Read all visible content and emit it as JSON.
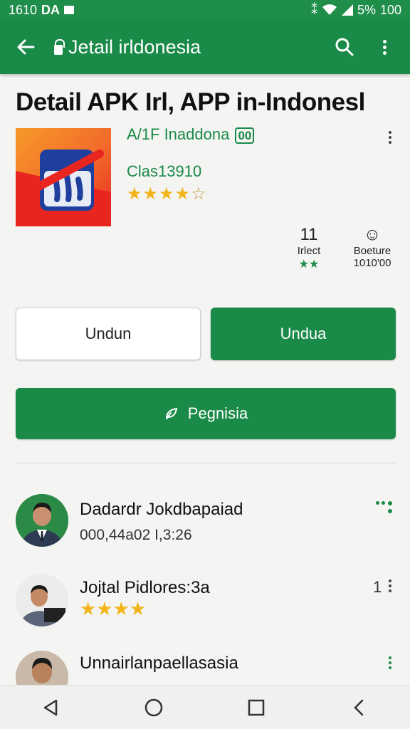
{
  "status_bar": {
    "time": "1610",
    "carrier": "DA",
    "battery": "5%",
    "signal_text": "100"
  },
  "app_bar": {
    "title": "Jetail irldonesia"
  },
  "page": {
    "title": "Detail APK Irl, APP in-Indonesl"
  },
  "app": {
    "name": "A/1F Inaddona",
    "badge": "00",
    "developer": "Clas13910",
    "rating_stars": 4.5
  },
  "stats": [
    {
      "value": "11",
      "label": "Irlect",
      "sub": "★★"
    },
    {
      "value": "☺",
      "label": "Boeture",
      "sub": "1010'00"
    }
  ],
  "buttons": {
    "secondary_label": "Undun",
    "primary_label": "Undua",
    "wide_label": "Pegnisia"
  },
  "reviews": [
    {
      "name": "Dadardr Jokdbapaiad",
      "detail": "000,44a02 I,3:26"
    },
    {
      "name": "Jojtal Pidlores:3a",
      "detail": "★★★★",
      "count": "1"
    },
    {
      "name": "Unnairlanpaellasasia",
      "detail": ""
    }
  ],
  "colors": {
    "primary_green": "#1a8a48",
    "star": "#f2b418"
  }
}
